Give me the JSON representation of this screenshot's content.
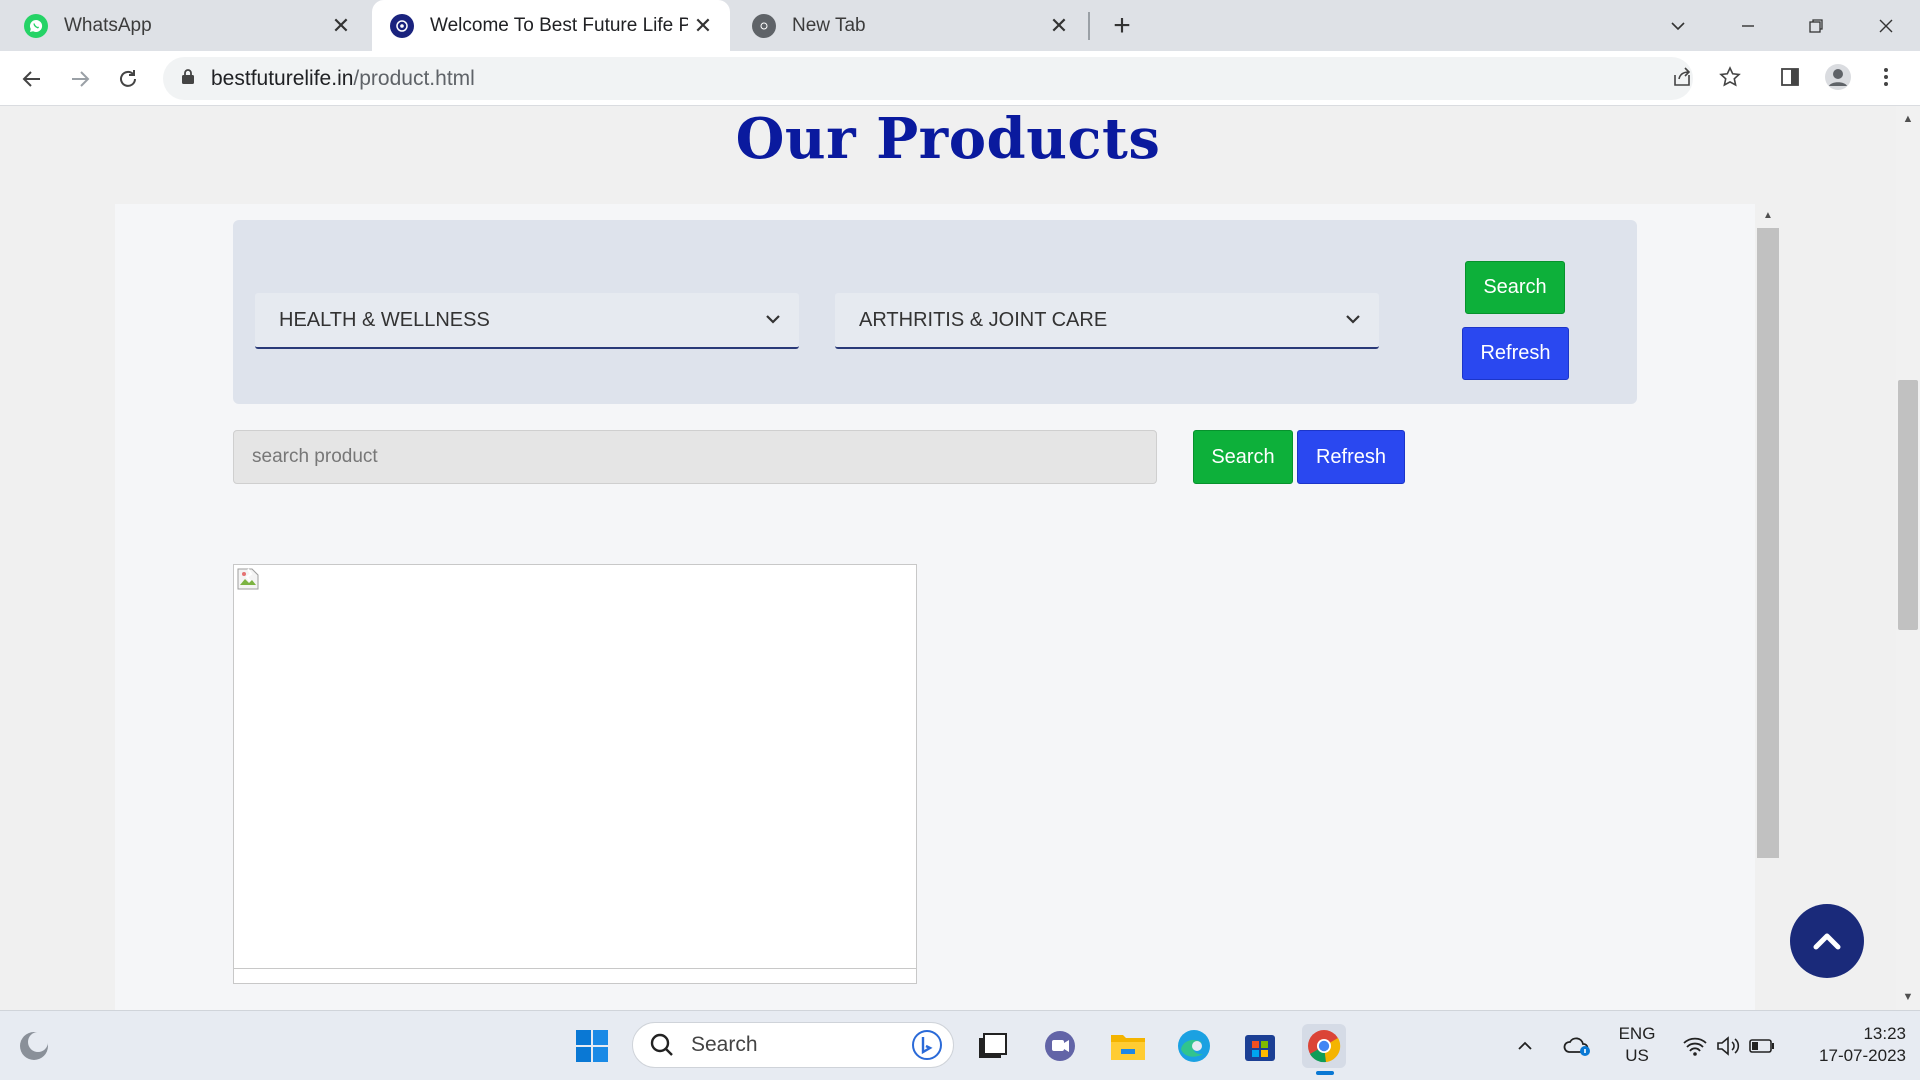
{
  "browser": {
    "tabs": [
      {
        "label": "WhatsApp",
        "active": false,
        "icon": "whatsapp-icon"
      },
      {
        "label": "Welcome To Best Future Life Pvt.",
        "active": true,
        "icon": "site-logo-icon"
      },
      {
        "label": "New Tab",
        "active": false,
        "icon": "chrome-icon"
      }
    ],
    "url_host": "bestfuturelife.in",
    "url_path": "/product.html"
  },
  "page": {
    "title": "Our Products",
    "filters": {
      "category_selected": "HEALTH & WELLNESS",
      "subcategory_selected": "ARTHRITIS & JOINT CARE",
      "search_label": "Search",
      "refresh_label": "Refresh"
    },
    "product_search": {
      "placeholder": "search product",
      "value": "",
      "search_label": "Search",
      "refresh_label": "Refresh"
    }
  },
  "taskbar": {
    "search_placeholder": "Search",
    "language_line1": "ENG",
    "language_line2": "US",
    "time": "13:23",
    "date": "17-07-2023"
  },
  "colors": {
    "title": "#0a1a9e",
    "search_button": "#0db03a",
    "refresh_button": "#2a48f0",
    "back_to_top": "#1a2a7a"
  }
}
